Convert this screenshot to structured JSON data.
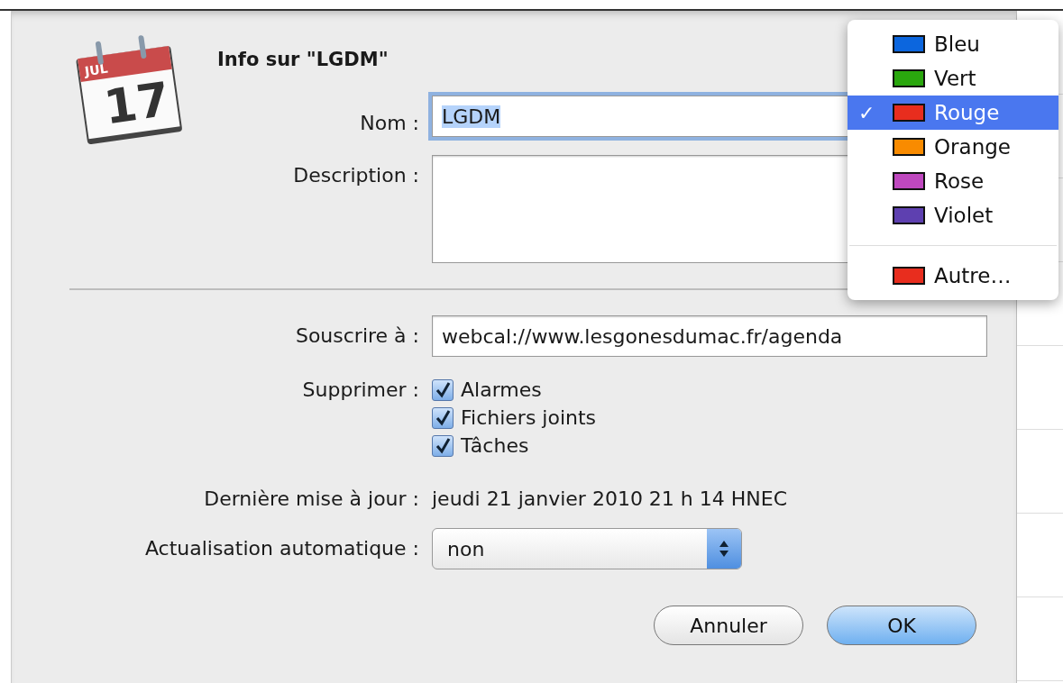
{
  "dialog": {
    "title": "Info sur \"LGDM\"",
    "app_icon": {
      "month": "JUL",
      "day": "17"
    },
    "name": {
      "label": "Nom :",
      "value": "LGDM",
      "value_selected": true,
      "focused": true
    },
    "description": {
      "label": "Description :"
    },
    "subscribe": {
      "label": "Souscrire à :",
      "value": "webcal://www.lesgonesdumac.fr/agenda"
    },
    "remove": {
      "label": "Supprimer :",
      "options": [
        {
          "label": "Alarmes",
          "checked": true
        },
        {
          "label": "Fichiers joints",
          "checked": true
        },
        {
          "label": "Tâches",
          "checked": true
        }
      ]
    },
    "last_update": {
      "label": "Dernière mise à jour :",
      "value": "jeudi 21 janvier 2010 21 h 14 HNEC"
    },
    "auto_refresh": {
      "label": "Actualisation automatique :",
      "value": "non"
    },
    "buttons": [
      {
        "label": "Annuler",
        "default": false
      },
      {
        "label": "OK",
        "default": true
      }
    ]
  },
  "color_menu": {
    "check_mark": "✓",
    "items": [
      {
        "kind": "color",
        "label": "Bleu",
        "color": "#0c66de",
        "selected": false
      },
      {
        "kind": "color",
        "label": "Vert",
        "color": "#2aa70e",
        "selected": false
      },
      {
        "kind": "color",
        "label": "Rouge",
        "color": "#e82d1e",
        "selected": true
      },
      {
        "kind": "color",
        "label": "Orange",
        "color": "#f98b00",
        "selected": false
      },
      {
        "kind": "color",
        "label": "Rose",
        "color": "#bf48bf",
        "selected": false
      },
      {
        "kind": "color",
        "label": "Violet",
        "color": "#5e40b0",
        "selected": false
      },
      {
        "kind": "custom",
        "label": "Autre…",
        "color": "#e82d1e",
        "selected": false
      }
    ]
  }
}
